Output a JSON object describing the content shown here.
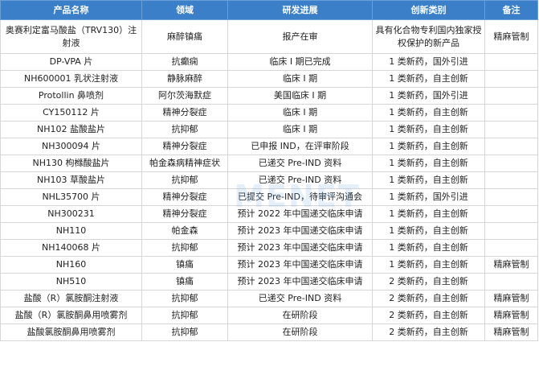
{
  "table": {
    "headers": [
      "产品名称",
      "领域",
      "研发进展",
      "创新类别",
      "备注"
    ],
    "rows": [
      [
        "奥赛利定富马酸盐（TRV130）注射液",
        "麻醉镇痛",
        "报产在审",
        "具有化合物专利国内独家授权保护的新产品",
        "精麻管制"
      ],
      [
        "DP-VPA 片",
        "抗癫痫",
        "临床 I 期已完成",
        "1 类新药，国外引进",
        ""
      ],
      [
        "NH600001 乳状注射液",
        "静脉麻醉",
        "临床 I 期",
        "1 类新药，自主创新",
        ""
      ],
      [
        "Protollin 鼻喷剂",
        "阿尔茨海默症",
        "美国临床 I 期",
        "1 类新药，国外引进",
        ""
      ],
      [
        "CY150112 片",
        "精神分裂症",
        "临床 I 期",
        "1 类新药，自主创新",
        ""
      ],
      [
        "NH102 盐酸盐片",
        "抗抑郁",
        "临床 I 期",
        "1 类新药，自主创新",
        ""
      ],
      [
        "NH300094 片",
        "精神分裂症",
        "已申报 IND，在评审阶段",
        "1 类新药，自主创新",
        ""
      ],
      [
        "NH130 枸橼酸盐片",
        "帕金森病精神症状",
        "已递交 Pre-IND 资料",
        "1 类新药，自主创新",
        ""
      ],
      [
        "NH103 草酸盐片",
        "抗抑郁",
        "已递交 Pre-IND 资料",
        "1 类新药，自主创新",
        ""
      ],
      [
        "NHL35700 片",
        "精神分裂症",
        "已提交  Pre-IND，待审评沟通会",
        "1 类新药，国外引进",
        ""
      ],
      [
        "NH300231",
        "精神分裂症",
        "预计 2022 年中国递交临床申请",
        "1 类新药，自主创新",
        ""
      ],
      [
        "NH110",
        "帕金森",
        "预计 2023 年中国递交临床申请",
        "1 类新药，自主创新",
        ""
      ],
      [
        "NH140068 片",
        "抗抑郁",
        "预计 2023 年中国递交临床申请",
        "1 类新药，自主创新",
        ""
      ],
      [
        "NH160",
        "镇痛",
        "预计 2023 年中国递交临床申请",
        "1 类新药，自主创新",
        "精麻管制"
      ],
      [
        "NH510",
        "镇痛",
        "预计 2023 年中国递交临床申请",
        "2 类新药，自主创新",
        ""
      ],
      [
        "盐酸（R）氯胺酮注射液",
        "抗抑郁",
        "已递交 Pre-IND 资料",
        "2 类新药，自主创新",
        "精麻管制"
      ],
      [
        "盐酸（R）氯胺酮鼻用喷雾剂",
        "抗抑郁",
        "在研阶段",
        "2 类新药，自主创新",
        "精麻管制"
      ],
      [
        "盐酸氯胺酮鼻用喷雾剂",
        "抗抑郁",
        "在研阶段",
        "2 类新药，自主创新",
        "精麻管制"
      ]
    ]
  }
}
